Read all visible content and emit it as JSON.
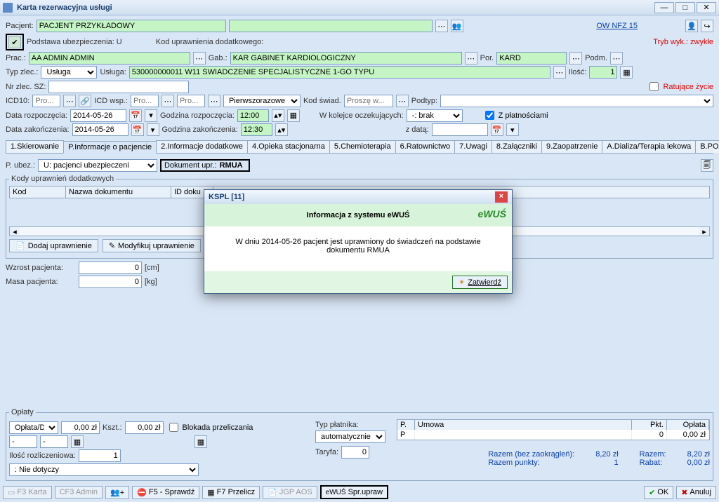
{
  "window": {
    "title": "Karta rezerwacyjna usługi"
  },
  "header": {
    "patient_label": "Pacjent:",
    "patient_value": "PACJENT PRZYKŁADOWY",
    "ownfz": "OW NFZ 15",
    "podst_ubez_label": "Podstawa ubezpieczenia: U",
    "kod_upr_label": "Kod uprawnienia dodatkowego:",
    "tryb_label": "Tryb wyk.: zwykłe",
    "prac_label": "Prac.:",
    "prac_value": "AA ADMIN ADMIN",
    "gab_label": "Gab.:",
    "gab_value": "KAR GABINET KARDIOLOGICZNY",
    "por_label": "Por.",
    "por_value": "KARD",
    "podm_label": "Podm.",
    "typ_zlec_label": "Typ zlec.:",
    "typ_zlec_value": "Usługa",
    "usluga_label": "Usługa:",
    "usluga_value": "530000000011 W11 ŚWIADCZENIE SPECJALISTYCZNE 1-GO TYPU",
    "ilosc_label": "Ilość:",
    "ilosc_value": "1",
    "nrzlec_label": "Nr zlec. SZ:",
    "ratujace": "Ratujące życie",
    "icd10_label": "ICD10:",
    "icd_wsp_label": "ICD wsp.:",
    "pierwszorazowe": "Pierwszorazowe",
    "kodswiad_label": "Kod świad.",
    "kodswiad_ph": "Proszę w...",
    "podtyp_label": "Podtyp:",
    "data_rozp_label": "Data rozpoczęcia:",
    "data_rozp_value": "2014-05-26",
    "godz_rozp_label": "Godzina rozpoczęcia:",
    "godz_rozp_value": "12:00",
    "wkolejce_label": "W kolejce oczekujących:",
    "wkolejce_value": "-: brak",
    "zplat": "Z płatnościami",
    "data_zak_label": "Data zakończenia:",
    "data_zak_value": "2014-05-26",
    "godz_zak_label": "Godzina zakończenia:",
    "godz_zak_value": "12:30",
    "zdata_label": "z datą:",
    "pro_ph": "Pro..."
  },
  "tabs": [
    "1.Skierowanie",
    "P.Informacje o pacjencie",
    "2.Informacje dodatkowe",
    "4.Opieka stacjonarna",
    "5.Chemioterapia",
    "6.Ratownictwo",
    "7.Uwagi",
    "8.Załączniki",
    "9.Zaopatrzenie",
    "A.Dializa/Terapia lekowa",
    "B.POZ"
  ],
  "pinfo": {
    "pubez_label": "P. ubez.:",
    "pubez_value": "U: pacjenci ubezpieczeni",
    "dokupr_label": "Dokument upr.:",
    "dokupr_value": "RMUA",
    "legend": "Kody uprawnień dodatkowych",
    "cols": {
      "kod": "Kod",
      "nazwa": "Nazwa dokumentu",
      "iddok": "ID doku"
    },
    "dodaj": "Dodaj uprawnienie",
    "modyfikuj": "Modyfikuj uprawnienie",
    "wzrost_label": "Wzrost pacjenta:",
    "wzrost_val": "0",
    "wzrost_unit": "[cm]",
    "masa_label": "Masa pacjenta:",
    "masa_val": "0",
    "masa_unit": "[kg]"
  },
  "dialog": {
    "title": "KSPL [11]",
    "header": "Informacja z systemu eWUŚ",
    "body": "W dniu 2014-05-26 pacjent jest uprawniony do świadczeń na podstawie dokumentu RMUA",
    "confirm": "Zatwierdź",
    "ewus_icon": "eWUŚ"
  },
  "oplaty": {
    "legend": "Opłaty",
    "opldata": "Opłata/Da",
    "zl0": "0,00 zł",
    "kszt_label": "Kszt.:",
    "kszt_val": "0,00 zł",
    "blokada": "Blokada przeliczania",
    "typplatnika": "Typ płatnika:",
    "auto": "automatycznie",
    "taryfa": "Taryfa:",
    "taryfa_val": "0",
    "ilrozl_label": "Ilość rozliczeniowa:",
    "ilrozl_val": "1",
    "niedotyczy": ": Nie dotyczy",
    "cols": {
      "p": "P.",
      "umowa": "Umowa",
      "pkt": "Pkt.",
      "oplata": "Opłata"
    },
    "row": {
      "p": "P",
      "umowa": "",
      "pkt": "0",
      "oplata": "0,00 zł"
    },
    "razem_bez": "Razem (bez zaokrągleń):",
    "razem_bez_val": "8,20 zł",
    "razem_pkt": "Razem punkty:",
    "razem_pkt_val": "1",
    "razem": "Razem:",
    "razem_val": "8,20 zł",
    "rabat": "Rabat:",
    "rabat_val": "0,00 zł"
  },
  "footer": {
    "f3karta": "F3 Karta",
    "cf3admin": "CF3 Admin",
    "f5": "F5 - Sprawdź",
    "f7": "F7 Przelicz",
    "jgp": "JGP AOS",
    "spr": "Spr.upraw",
    "ok": "OK",
    "anuluj": "Anuluj"
  }
}
